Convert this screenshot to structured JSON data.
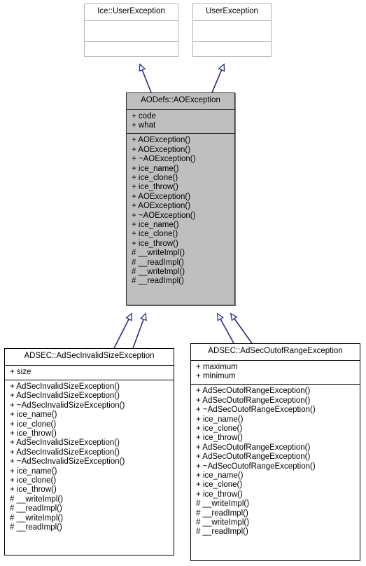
{
  "diagram": {
    "type": "uml-class-inheritance",
    "title": "AODefs::AOException inheritance diagram",
    "edge_color": "#2a2a8c",
    "filled_class_bg": "#bfbfbf",
    "classes": [
      {
        "id": "ice-user-exception",
        "name": "Ice::UserException",
        "style": "light",
        "attributes": [],
        "operations": []
      },
      {
        "id": "user-exception",
        "name": "UserException",
        "style": "light",
        "attributes": [],
        "operations": []
      },
      {
        "id": "aodefs-aoexception",
        "name": "AODefs::AOException",
        "style": "filled",
        "attributes": [
          "+ code",
          "+ what"
        ],
        "operations": [
          "+ AOException()",
          "+ AOException()",
          "+ ~AOException()",
          "+ ice_name()",
          "+ ice_clone()",
          "+ ice_throw()",
          "+ AOException()",
          "+ AOException()",
          "+ ~AOException()",
          "+ ice_name()",
          "+ ice_clone()",
          "+ ice_throw()",
          "# __writeImpl()",
          "# __readImpl()",
          "# __writeImpl()",
          "# __readImpl()"
        ]
      },
      {
        "id": "adsec-invalidsize",
        "name": "ADSEC::AdSecInvalidSizeException",
        "style": "plain",
        "attributes": [
          "+ size"
        ],
        "operations": [
          "+ AdSecInvalidSizeException()",
          "+ AdSecInvalidSizeException()",
          "+ ~AdSecInvalidSizeException()",
          "+ ice_name()",
          "+ ice_clone()",
          "+ ice_throw()",
          "+ AdSecInvalidSizeException()",
          "+ AdSecInvalidSizeException()",
          "+ ~AdSecInvalidSizeException()",
          "+ ice_name()",
          "+ ice_clone()",
          "+ ice_throw()",
          "# __writeImpl()",
          "# __readImpl()",
          "# __writeImpl()",
          "# __readImpl()"
        ]
      },
      {
        "id": "adsec-outofrange",
        "name": "ADSEC::AdSecOutofRangeException",
        "style": "plain",
        "attributes": [
          "+ maximum",
          "+ minimum"
        ],
        "operations": [
          "+ AdSecOutofRangeException()",
          "+ AdSecOutofRangeException()",
          "+ ~AdSecOutofRangeException()",
          "+ ice_name()",
          "+ ice_clone()",
          "+ ice_throw()",
          "+ AdSecOutofRangeException()",
          "+ AdSecOutofRangeException()",
          "+ ~AdSecOutofRangeException()",
          "+ ice_name()",
          "+ ice_clone()",
          "+ ice_throw()",
          "# __writeImpl()",
          "# __readImpl()",
          "# __writeImpl()",
          "# __readImpl()"
        ]
      }
    ],
    "inheritance_edges": [
      {
        "from": "aodefs-aoexception",
        "to": "ice-user-exception"
      },
      {
        "from": "aodefs-aoexception",
        "to": "user-exception"
      },
      {
        "from": "adsec-invalidsize",
        "to": "aodefs-aoexception"
      },
      {
        "from": "adsec-invalidsize",
        "to": "aodefs-aoexception"
      },
      {
        "from": "adsec-outofrange",
        "to": "aodefs-aoexception"
      },
      {
        "from": "adsec-outofrange",
        "to": "aodefs-aoexception"
      }
    ]
  }
}
